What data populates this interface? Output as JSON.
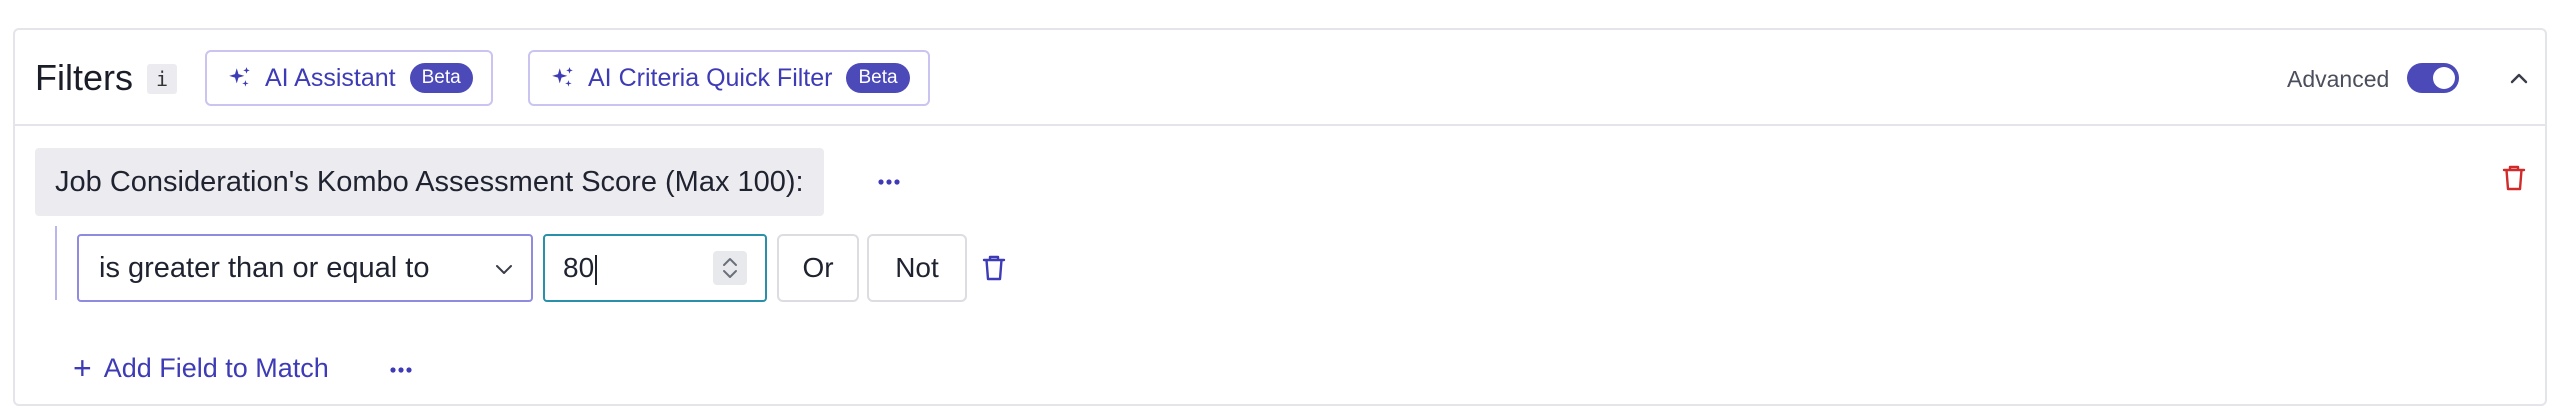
{
  "header": {
    "title": "Filters",
    "info_icon_text": "i",
    "ai_buttons": [
      {
        "label": "AI Assistant",
        "badge": "Beta"
      },
      {
        "label": "AI Criteria Quick Filter",
        "badge": "Beta"
      }
    ],
    "advanced_label": "Advanced",
    "advanced_enabled": true
  },
  "filter": {
    "field_label": "Job Consideration's Kombo Assessment Score (Max 100):",
    "condition": {
      "operator": "is greater than or equal to",
      "value": "80"
    },
    "or_label": "Or",
    "not_label": "Not",
    "add_field_label": "Add Field to Match"
  },
  "colors": {
    "accent": "#4b4ab8",
    "link": "#3d3bb5",
    "danger": "#d12a2a",
    "input_focus": "#2a8fa8",
    "tag_bg": "#ececf0"
  },
  "icons": {
    "sparkle": "sparkle-icon",
    "info": "info-icon",
    "collapse": "chevron-up-icon",
    "more": "more-horizontal-icon",
    "delete": "trash-icon",
    "dropdown": "chevron-down-icon",
    "stepper": "stepper-icon",
    "add": "plus-icon"
  }
}
